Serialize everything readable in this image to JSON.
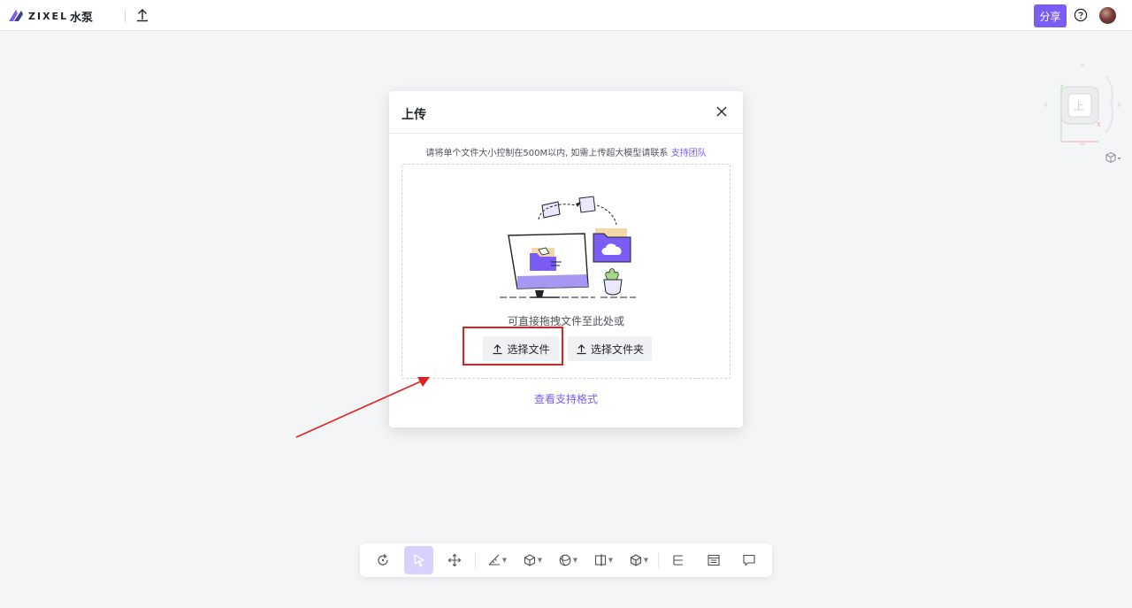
{
  "app": {
    "logo_text": "ZIXEL",
    "document_title": "水泵",
    "share_label": "分享",
    "brand_color": "#7b5cf5"
  },
  "icons": {
    "logo": "zixel-logo-icon",
    "upload": "upload-icon",
    "help": "help-circle-icon",
    "avatar": "user-avatar",
    "close": "close-icon",
    "viewcube": "view-cube-icon"
  },
  "modal": {
    "title": "上传",
    "notice_text": "请将单个文件大小控制在500M以内, 如需上传超大模型请联系 ",
    "notice_link": "支持团队",
    "drop_hint": "可直接拖拽文件至此处或",
    "select_file_label": "选择文件",
    "select_folder_label": "选择文件夹",
    "formats_link": "查看支持格式"
  },
  "viewcube": {
    "face_label": "上",
    "axis_x": "X",
    "axis_y": "Y"
  },
  "toolbar": {
    "items": [
      {
        "name": "reset-view",
        "icon": "rotate-icon",
        "active": false,
        "dropdown": false
      },
      {
        "name": "select",
        "icon": "cursor-icon",
        "active": true,
        "dropdown": false
      },
      {
        "name": "move",
        "icon": "move-icon",
        "active": false,
        "dropdown": false
      },
      {
        "name": "measure",
        "icon": "ruler-icon",
        "active": false,
        "dropdown": true
      },
      {
        "name": "explode",
        "icon": "explode-cube-icon",
        "active": false,
        "dropdown": true
      },
      {
        "name": "render-style",
        "icon": "sphere-icon",
        "active": false,
        "dropdown": true
      },
      {
        "name": "section",
        "icon": "section-icon",
        "active": false,
        "dropdown": true
      },
      {
        "name": "display",
        "icon": "cube-icon",
        "active": false,
        "dropdown": true
      },
      {
        "name": "model-tree",
        "icon": "tree-icon",
        "active": false,
        "dropdown": false
      },
      {
        "name": "properties",
        "icon": "properties-icon",
        "active": false,
        "dropdown": false
      },
      {
        "name": "comments",
        "icon": "comment-icon",
        "active": false,
        "dropdown": false
      }
    ]
  }
}
